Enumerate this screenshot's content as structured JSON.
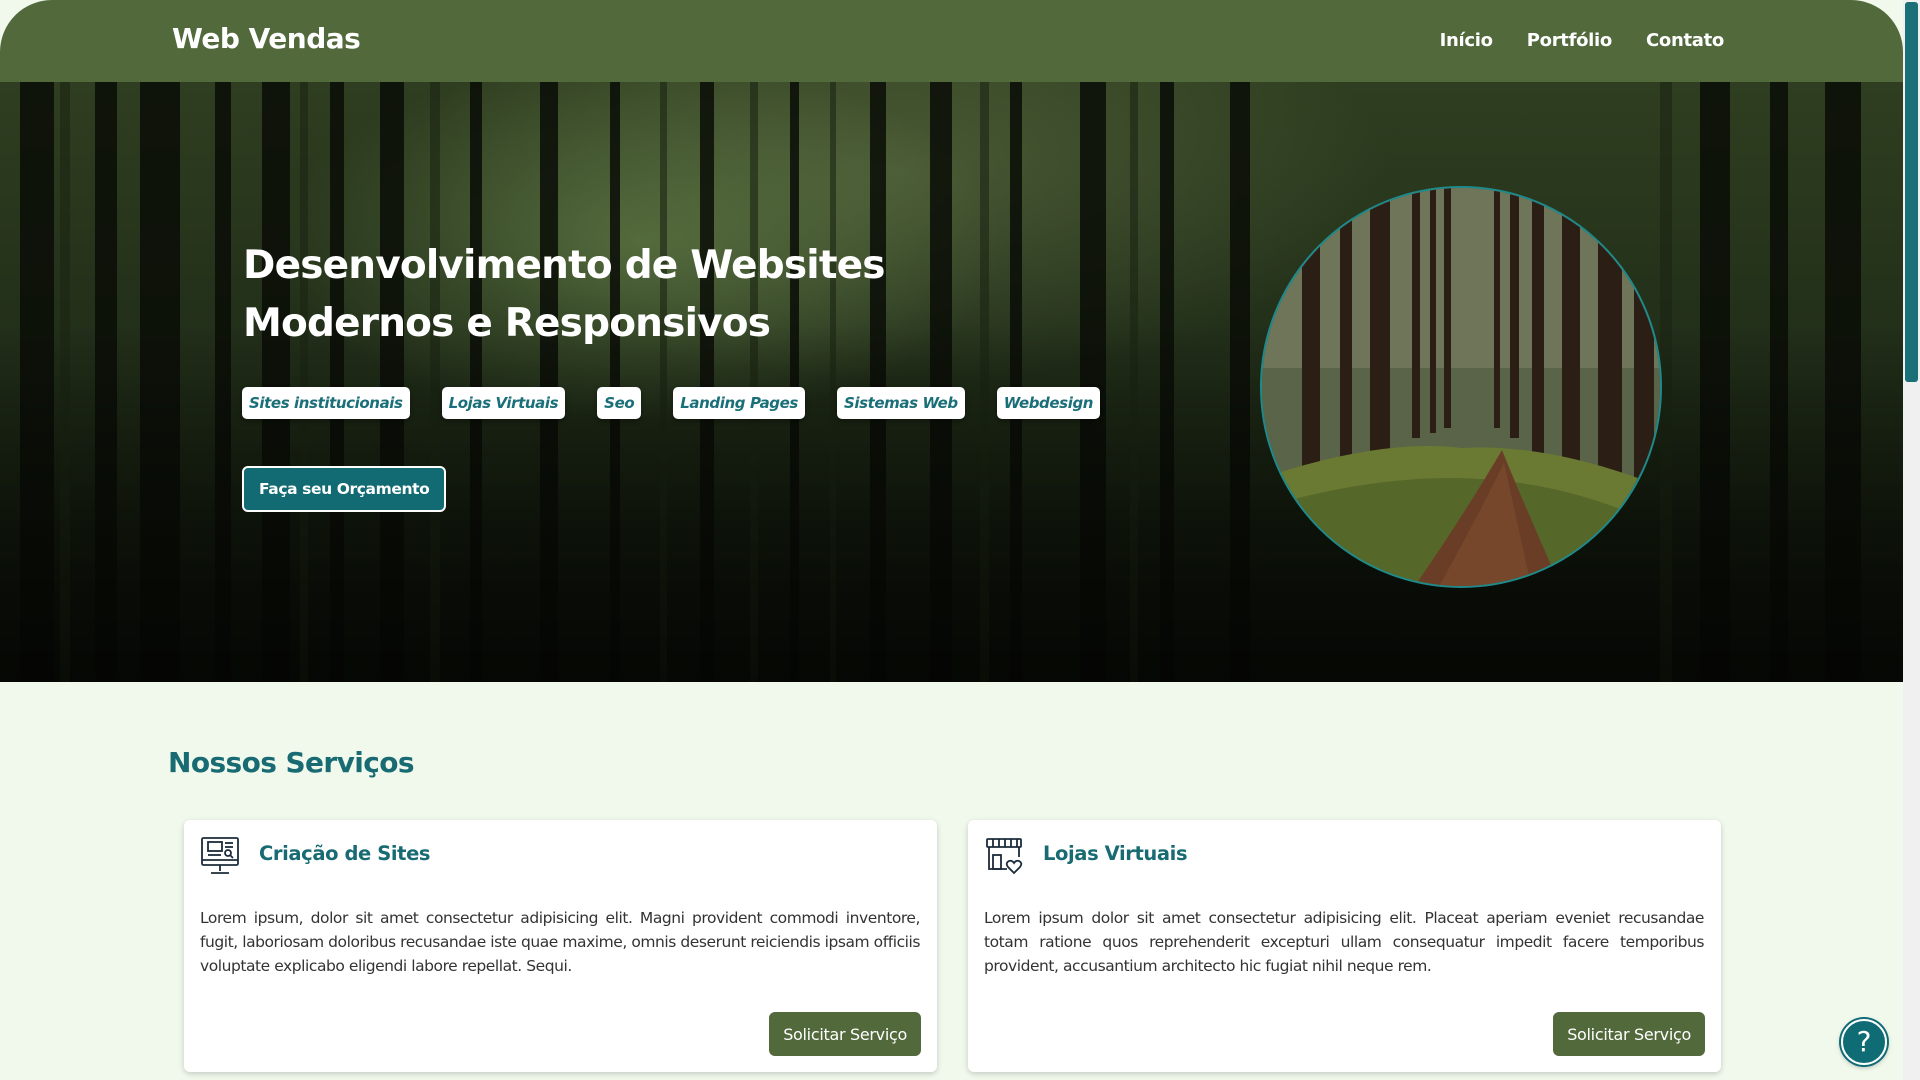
{
  "header": {
    "brand": "Web Vendas",
    "nav": [
      {
        "label": "Início"
      },
      {
        "label": "Portfólio"
      },
      {
        "label": "Contato"
      }
    ]
  },
  "hero": {
    "title_line1": "Desenvolvimento de Websites",
    "title_line2": "Modernos e Responsivos",
    "tags": [
      "Sites institucionais",
      "Lojas Virtuais",
      "Seo",
      "Landing Pages",
      "Sistemas Web",
      "Webdesign"
    ],
    "cta_label": "Faça seu Orçamento",
    "image": "forest-path-photo"
  },
  "services": {
    "title": "Nossos Serviços",
    "cards": [
      {
        "icon": "website-monitor-icon",
        "title": "Criação de Sites",
        "text": "Lorem ipsum, dolor sit amet consectetur adipisicing elit. Magni provident commodi inventore, fugit, laboriosam doloribus recusandae iste quae maxime, omnis deserunt reiciendis ipsam officiis voluptate explicabo eligendi labore repellat. Sequi.",
        "button": "Solicitar Serviço"
      },
      {
        "icon": "online-store-icon",
        "title": "Lojas Virtuais",
        "text": "Lorem ipsum dolor sit amet consectetur adipisicing elit. Placeat aperiam eveniet recusandae totam ratione quos reprehenderit excepturi ullam consequatur impedit facere temporibus provident, accusantium architecto hic fugiat nihil neque rem.",
        "button": "Solicitar Serviço"
      }
    ]
  },
  "help": {
    "label": "?"
  },
  "colors": {
    "header": "#52693b",
    "accent": "#186b72",
    "button": "#52693b",
    "background": "#f1f8ec"
  }
}
